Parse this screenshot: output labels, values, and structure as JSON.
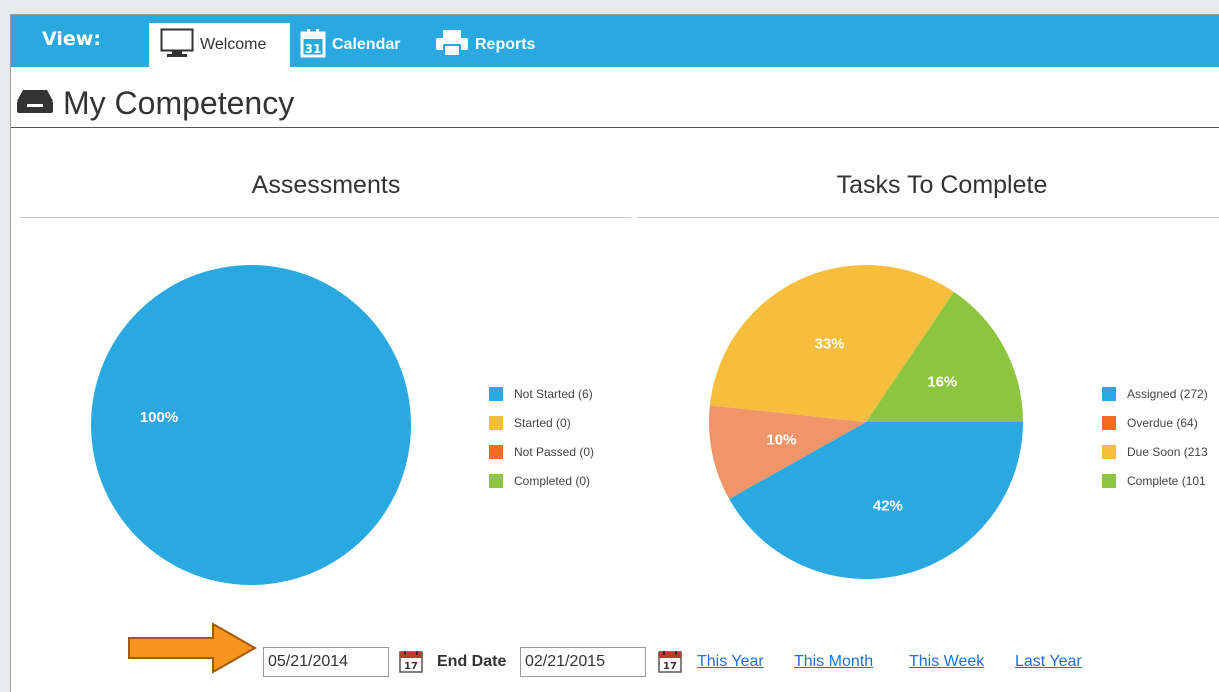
{
  "header": {
    "view_label": "View:",
    "tabs": [
      {
        "label": "Welcome",
        "icon": "monitor-icon",
        "active": true
      },
      {
        "label": "Calendar",
        "icon": "calendar-icon",
        "active": false
      },
      {
        "label": "Reports",
        "icon": "printer-icon",
        "active": false
      }
    ],
    "accent_color": "#2aa9e0"
  },
  "page": {
    "title": "My Competency",
    "title_icon": "inbox-tray-icon"
  },
  "assessments": {
    "title": "Assessments",
    "legend": [
      {
        "label": "Not Started (6)",
        "color": "#2aa9e0"
      },
      {
        "label": "Started (0)",
        "color": "#f7bd3c"
      },
      {
        "label": "Not Passed (0)",
        "color": "#f26b21"
      },
      {
        "label": "Completed (0)",
        "color": "#8cc63f"
      }
    ]
  },
  "tasks": {
    "title": "Tasks To Complete",
    "legend": [
      {
        "label": "Assigned (272)",
        "color": "#2aa9e0"
      },
      {
        "label": "Overdue (64)",
        "color": "#f26b21"
      },
      {
        "label": "Due Soon (213",
        "color": "#f7bd3c"
      },
      {
        "label": "Complete (101",
        "color": "#8cc63f"
      }
    ]
  },
  "chart_data": [
    {
      "type": "pie",
      "title": "Assessments",
      "labels": [
        "Not Started",
        "Started",
        "Not Passed",
        "Completed"
      ],
      "values": [
        6,
        0,
        0,
        0
      ],
      "percent_labels": [
        "100%",
        "",
        "",
        ""
      ],
      "colors": [
        "#2aa9e0",
        "#f7bd3c",
        "#f26b21",
        "#8cc63f"
      ]
    },
    {
      "type": "pie",
      "title": "Tasks To Complete",
      "labels": [
        "Assigned",
        "Overdue",
        "Due Soon",
        "Complete"
      ],
      "values": [
        272,
        64,
        213,
        101
      ],
      "percent_labels": [
        "42%",
        "10%",
        "33%",
        "16%"
      ],
      "colors": [
        "#2aa9e0",
        "#f0956a",
        "#f7bd3c",
        "#8cc63f"
      ]
    }
  ],
  "date_filter": {
    "start_date": "05/21/2014",
    "end_label": "End Date",
    "end_date": "02/21/2015",
    "calendar_icon_day": "17",
    "quick_links": [
      "This Year",
      "This Month",
      "This Week",
      "Last Year"
    ]
  }
}
